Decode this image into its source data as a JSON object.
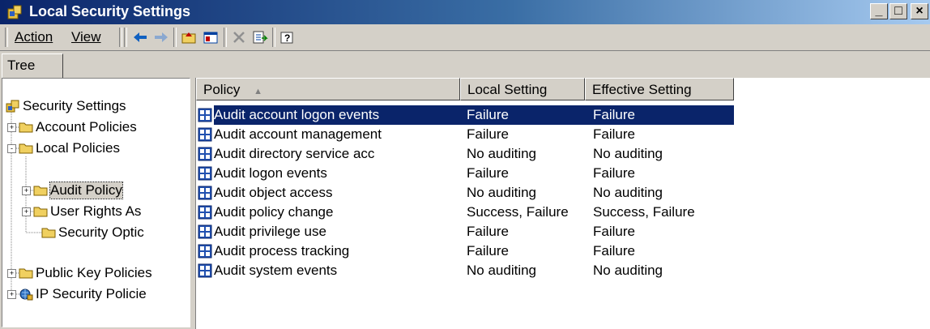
{
  "window": {
    "title": "Local Security Settings",
    "buttons": [
      "_",
      "□",
      "×"
    ]
  },
  "menu": [
    {
      "label": "Action",
      "accel": "A"
    },
    {
      "label": "View",
      "accel": "V"
    }
  ],
  "toolbar_icons": [
    "back-arrow-icon",
    "forward-arrow-icon",
    "up-folder-icon",
    "show-hide-tree-icon",
    "delete-icon",
    "export-list-icon",
    "help-icon"
  ],
  "tree": {
    "tab_label": "Tree",
    "items": [
      {
        "label": "Security Settings",
        "level": 0,
        "expander": "",
        "icon": "security-settings-icon"
      },
      {
        "label": "Account Policies",
        "level": 1,
        "expander": "+",
        "icon": "folder-icon"
      },
      {
        "label": "Local Policies",
        "level": 1,
        "expander": "-",
        "icon": "folder-icon"
      },
      {
        "label": "Audit Policy",
        "level": 2,
        "expander": "+",
        "icon": "folder-icon",
        "selected": true
      },
      {
        "label": "User Rights As",
        "level": 2,
        "expander": "+",
        "icon": "folder-icon"
      },
      {
        "label": "Security Optic",
        "level": 2,
        "expander": "",
        "icon": "folder-icon"
      },
      {
        "label": "Public Key Policies",
        "level": 1,
        "expander": "+",
        "icon": "folder-icon"
      },
      {
        "label": "IP Security Policie",
        "level": 1,
        "expander": "+",
        "icon": "ip-security-icon"
      }
    ]
  },
  "list": {
    "columns": [
      "Policy",
      "Local Setting",
      "Effective Setting"
    ],
    "sort_indicator": "▲",
    "rows": [
      {
        "policy": "Audit account logon events",
        "local": "Failure",
        "effective": "Failure",
        "selected": true
      },
      {
        "policy": "Audit account management",
        "local": "Failure",
        "effective": "Failure"
      },
      {
        "policy": "Audit directory service acc",
        "local": "No auditing",
        "effective": "No auditing"
      },
      {
        "policy": "Audit logon events",
        "local": "Failure",
        "effective": "Failure"
      },
      {
        "policy": "Audit object access",
        "local": "No auditing",
        "effective": "No auditing"
      },
      {
        "policy": "Audit policy change",
        "local": "Success, Failure",
        "effective": "Success, Failure"
      },
      {
        "policy": "Audit privilege use",
        "local": "Failure",
        "effective": "Failure"
      },
      {
        "policy": "Audit process tracking",
        "local": "Failure",
        "effective": "Failure"
      },
      {
        "policy": "Audit system events",
        "local": "No auditing",
        "effective": "No auditing"
      }
    ]
  },
  "colors": {
    "titlebar_start": "#0a246a",
    "titlebar_end": "#a6caf0",
    "selection": "#0a246a",
    "face": "#d4d0c8"
  }
}
